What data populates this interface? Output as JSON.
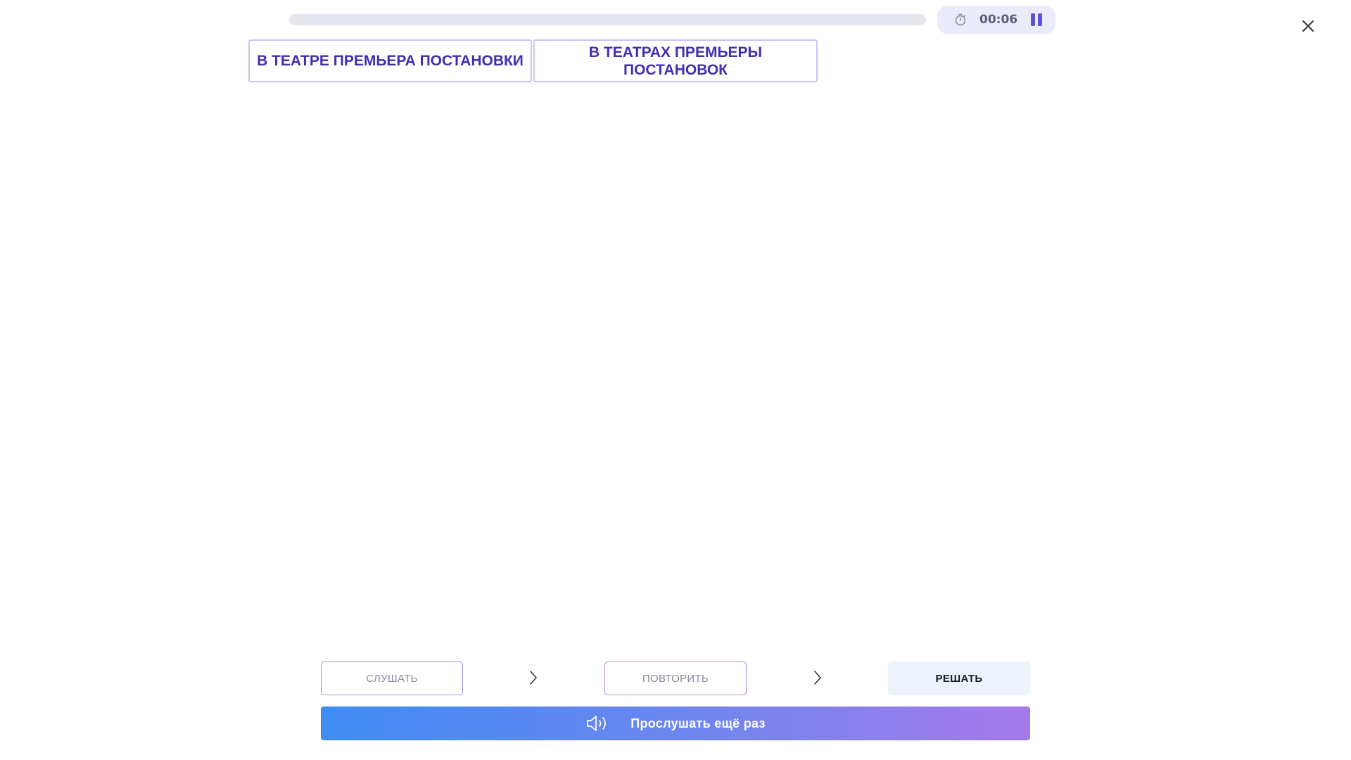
{
  "progress": {
    "fraction": 0.0
  },
  "timer": {
    "time": "00:06"
  },
  "cards": [
    {
      "text": "В ТЕАТРЕ ПРЕМЬЕРА ПОСТАНОВКИ"
    },
    {
      "text": "В ТЕАТРАХ ПРЕМЬЕРЫ ПОСТАНОВОК"
    }
  ],
  "steps": {
    "listen": "СЛУШАТЬ",
    "repeat": "ПОВТОРИТЬ",
    "solve": "РЕШАТЬ"
  },
  "listen_again": {
    "label": "Прослушать ещё раз"
  },
  "icons": {
    "timer": "stopwatch-icon",
    "pause": "pause-icon",
    "close": "close-icon",
    "chevron": "chevron-right-icon",
    "speaker": "speaker-icon"
  },
  "colors": {
    "accent": "#3f2fb0",
    "pause": "#5a55d6",
    "gradient_start": "#3f8cf5",
    "gradient_end": "#a57ae9"
  }
}
